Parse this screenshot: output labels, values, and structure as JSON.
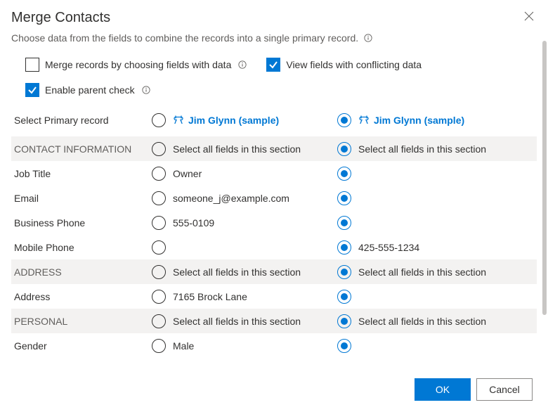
{
  "title": "Merge Contacts",
  "subtitle": "Choose data from the fields to combine the records into a single primary record.",
  "options": {
    "merge_by_data": {
      "label": "Merge records by choosing fields with data",
      "checked": false,
      "has_info": true
    },
    "view_conflicting": {
      "label": "View fields with conflicting data",
      "checked": true,
      "has_info": false
    },
    "enable_parent": {
      "label": "Enable parent check",
      "checked": true,
      "has_info": true
    }
  },
  "primary_label": "Select Primary record",
  "records": [
    {
      "name": "Jim Glynn (sample)",
      "selected": false
    },
    {
      "name": "Jim Glynn (sample)",
      "selected": true
    }
  ],
  "section_select_label_left": "Select all fields in this section",
  "section_select_label_right": "Select all fields in this section",
  "sections": [
    {
      "name": "CONTACT INFORMATION",
      "fields": [
        {
          "label": "Job Title",
          "left": "Owner",
          "right": "",
          "selected": "right"
        },
        {
          "label": "Email",
          "left": "someone_j@example.com",
          "right": "",
          "selected": "right"
        },
        {
          "label": "Business Phone",
          "left": "555-0109",
          "right": "",
          "selected": "right"
        },
        {
          "label": "Mobile Phone",
          "left": "",
          "right": "425-555-1234",
          "selected": "right"
        }
      ]
    },
    {
      "name": "ADDRESS",
      "fields": [
        {
          "label": "Address",
          "left": "7165 Brock Lane",
          "right": "",
          "selected": "right"
        }
      ]
    },
    {
      "name": "PERSONAL",
      "fields": [
        {
          "label": "Gender",
          "left": "Male",
          "right": "",
          "selected": "right"
        }
      ]
    }
  ],
  "buttons": {
    "ok": "OK",
    "cancel": "Cancel"
  }
}
